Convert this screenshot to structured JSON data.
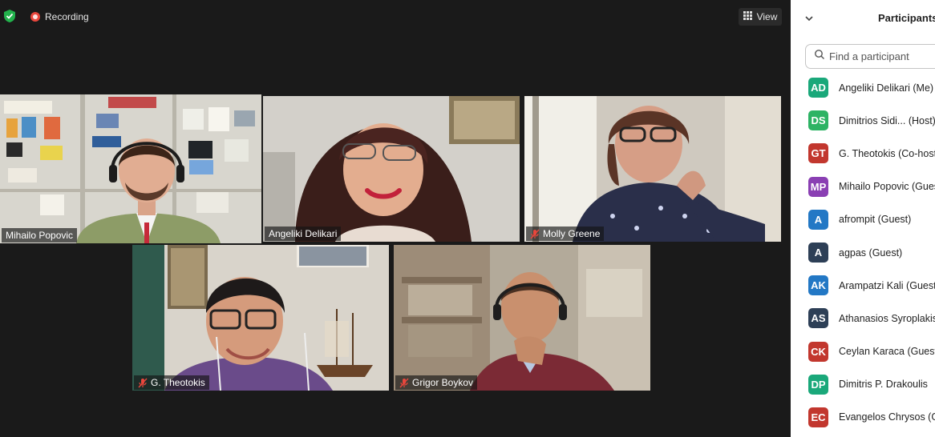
{
  "meeting": {
    "recording_label": "Recording",
    "view_label": "View"
  },
  "tiles": [
    {
      "name": "Mihailo Popovic",
      "muted": false
    },
    {
      "name": "Angeliki Delikari",
      "muted": false
    },
    {
      "name": "Molly Greene",
      "muted": true
    },
    {
      "name": "G. Theotokis",
      "muted": true
    },
    {
      "name": "Grigor Boykov",
      "muted": true
    }
  ],
  "participants": {
    "title": "Participants",
    "search_placeholder": "Find a participant",
    "items": [
      {
        "initials": "AD",
        "name": "Angeliki Delikari (Me)",
        "color": "#1aa87a"
      },
      {
        "initials": "DS",
        "name": "Dimitrios Sidi... (Host)",
        "color": "#2db364"
      },
      {
        "initials": "GT",
        "name": "G. Theotokis (Co-host)",
        "color": "#c2372e"
      },
      {
        "initials": "MP",
        "name": "Mihailo Popovic (Guest)",
        "color": "#8a3fb3"
      },
      {
        "initials": "A",
        "name": "afrompit (Guest)",
        "color": "#2378c5"
      },
      {
        "initials": "A",
        "name": "agpas (Guest)",
        "color": "#2d3f56"
      },
      {
        "initials": "AK",
        "name": "Arampatzi Kali (Guest)",
        "color": "#2378c5"
      },
      {
        "initials": "AS",
        "name": "Athanasios Syroplakis",
        "color": "#2d3f56"
      },
      {
        "initials": "CK",
        "name": "Ceylan Karaca (Guest)",
        "color": "#c2372e"
      },
      {
        "initials": "DP",
        "name": "Dimitris P. Drakoulis",
        "color": "#1aa87a"
      },
      {
        "initials": "EC",
        "name": "Evangelos Chrysos (G",
        "color": "#c2372e"
      }
    ]
  }
}
